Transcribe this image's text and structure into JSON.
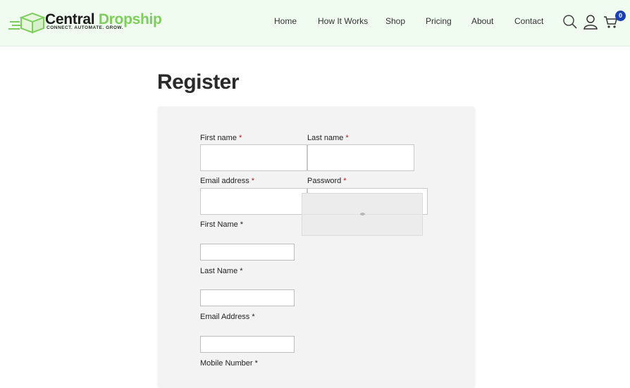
{
  "brand": {
    "name_part1": "Central",
    "name_part2": "Dropship",
    "tagline": "CONNECT. AUTOMATE. GROW.",
    "accent_color": "#7ccf5b"
  },
  "nav": {
    "items": [
      {
        "label": "Home"
      },
      {
        "label": "How It Works"
      },
      {
        "label": "Shop"
      },
      {
        "label": "Pricing"
      },
      {
        "label": "About"
      },
      {
        "label": "Contact"
      }
    ]
  },
  "header_icons": {
    "search": "search-icon",
    "account": "user-icon",
    "cart": "cart-icon",
    "cart_count": "0"
  },
  "page": {
    "title": "Register"
  },
  "form": {
    "first_name_label": "First name",
    "last_name_label": "Last name",
    "email_label": "Email address",
    "password_label": "Password",
    "first_name2_label": "First Name",
    "last_name2_label": "Last Name",
    "email2_label": "Email Address",
    "mobile_label": "Mobile Number",
    "required_mark": "*",
    "first_name_value": "",
    "last_name_value": "",
    "email_value": "",
    "password_value": "",
    "first_name2_value": "",
    "last_name2_value": "",
    "email2_value": "",
    "password_toggle_icon": "eye-icon"
  }
}
